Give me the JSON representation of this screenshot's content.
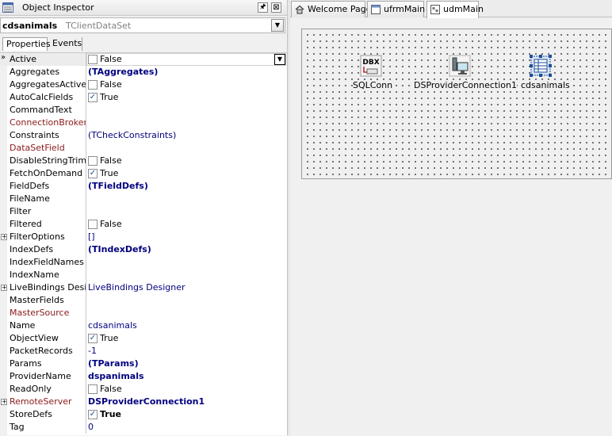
{
  "inspector": {
    "title": "Object Inspector",
    "pin_glyph": "🖈",
    "close_glyph": "⊠",
    "component_name": "cdsanimals",
    "component_class": "TClientDataSet",
    "tabs": [
      "Properties",
      "Events"
    ],
    "selection_marker": "»",
    "properties": [
      {
        "name": "Active",
        "value": "False",
        "checkbox": "unchecked",
        "selected": true,
        "red": false
      },
      {
        "name": "Aggregates",
        "value": "(TAggregates)",
        "bold": true
      },
      {
        "name": "AggregatesActive",
        "value": "False",
        "checkbox": "unchecked"
      },
      {
        "name": "AutoCalcFields",
        "value": "True",
        "checkbox": "checked"
      },
      {
        "name": "CommandText",
        "value": ""
      },
      {
        "name": "ConnectionBroker",
        "value": "",
        "red": true
      },
      {
        "name": "Constraints",
        "value": "(TCheckConstraints)"
      },
      {
        "name": "DataSetField",
        "value": "",
        "red": true
      },
      {
        "name": "DisableStringTrim",
        "value": "False",
        "checkbox": "unchecked"
      },
      {
        "name": "FetchOnDemand",
        "value": "True",
        "checkbox": "checked"
      },
      {
        "name": "FieldDefs",
        "value": "(TFieldDefs)",
        "bold": true
      },
      {
        "name": "FileName",
        "value": ""
      },
      {
        "name": "Filter",
        "value": ""
      },
      {
        "name": "Filtered",
        "value": "False",
        "checkbox": "unchecked"
      },
      {
        "name": "FilterOptions",
        "value": "[]",
        "expandable": true
      },
      {
        "name": "IndexDefs",
        "value": "(TIndexDefs)",
        "bold": true
      },
      {
        "name": "IndexFieldNames",
        "value": ""
      },
      {
        "name": "IndexName",
        "value": ""
      },
      {
        "name": "LiveBindings Designer",
        "value": "LiveBindings Designer",
        "expandable": true
      },
      {
        "name": "MasterFields",
        "value": ""
      },
      {
        "name": "MasterSource",
        "value": "",
        "red": true
      },
      {
        "name": "Name",
        "value": "cdsanimals"
      },
      {
        "name": "ObjectView",
        "value": "True",
        "checkbox": "checked"
      },
      {
        "name": "PacketRecords",
        "value": "-1"
      },
      {
        "name": "Params",
        "value": "(TParams)",
        "bold": true
      },
      {
        "name": "ProviderName",
        "value": "dspanimals",
        "bold": true
      },
      {
        "name": "ReadOnly",
        "value": "False",
        "checkbox": "unchecked"
      },
      {
        "name": "RemoteServer",
        "value": "DSProviderConnection1",
        "bold": true,
        "red": true,
        "expandable": true
      },
      {
        "name": "StoreDefs",
        "value": "True",
        "checkbox": "checked",
        "bold": true
      },
      {
        "name": "Tag",
        "value": "0"
      }
    ]
  },
  "editor_tabs": [
    {
      "label": "Welcome Page",
      "icon": "home-icon",
      "active": false
    },
    {
      "label": "ufrmMain",
      "icon": "form-icon",
      "active": false
    },
    {
      "label": "udmMain",
      "icon": "datamodule-icon",
      "active": true
    }
  ],
  "components": [
    {
      "label": "SQLConn",
      "icon": "dbx-sqlconnection-icon",
      "icon_text": "DBX",
      "selected": false
    },
    {
      "label": "DSProviderConnection1",
      "icon": "provider-connection-icon",
      "selected": false
    },
    {
      "label": "cdsanimals",
      "icon": "clientdataset-icon",
      "selected": true
    }
  ],
  "colors": {
    "value_blue": "#000080",
    "required_red": "#8b1a1a",
    "selection_blue": "#1c4d99"
  }
}
